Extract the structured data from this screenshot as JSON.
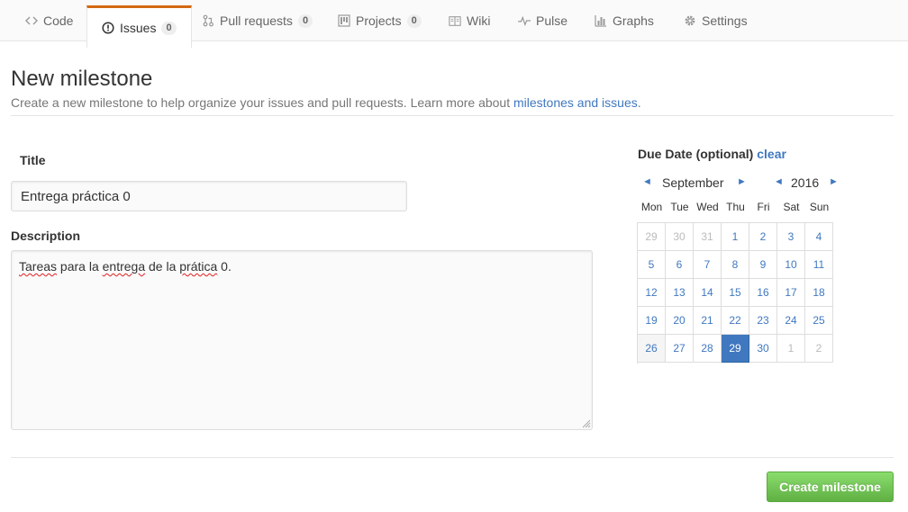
{
  "nav": {
    "tabs": [
      {
        "label": "Code",
        "icon": "code-icon"
      },
      {
        "label": "Issues",
        "icon": "issue-opened-icon",
        "count": "0",
        "selected": true
      },
      {
        "label": "Pull requests",
        "icon": "git-pull-request-icon",
        "count": "0"
      },
      {
        "label": "Projects",
        "icon": "project-icon",
        "count": "0"
      },
      {
        "label": "Wiki",
        "icon": "book-icon"
      },
      {
        "label": "Pulse",
        "icon": "pulse-icon"
      },
      {
        "label": "Graphs",
        "icon": "graph-icon"
      },
      {
        "label": "Settings",
        "icon": "gear-icon"
      }
    ],
    "accent_color": "#d26911"
  },
  "header": {
    "title": "New milestone",
    "subtitle": "Create a new milestone to help organize your issues and pull requests. Learn more about ",
    "link_text": "milestones and issues",
    "subtitle_end": "."
  },
  "form": {
    "title_label": "Title",
    "title_value": "Entrega práctica 0",
    "description_label": "Description",
    "description_words": [
      "Tareas",
      " para la ",
      "entrega",
      " de la ",
      "prática",
      " 0."
    ]
  },
  "due_date": {
    "label": "Due Date (optional)",
    "clear_label": "clear",
    "prev_arrow": "◄",
    "next_arrow": "►",
    "month": "September",
    "year": "2016",
    "weekdays": [
      "Mon",
      "Tue",
      "Wed",
      "Thu",
      "Fri",
      "Sat",
      "Sun"
    ],
    "weeks": [
      [
        "29",
        "30",
        "31",
        "1",
        "2",
        "3",
        "4"
      ],
      [
        "5",
        "6",
        "7",
        "8",
        "9",
        "10",
        "11"
      ],
      [
        "12",
        "13",
        "14",
        "15",
        "16",
        "17",
        "18"
      ],
      [
        "19",
        "20",
        "21",
        "22",
        "23",
        "24",
        "25"
      ],
      [
        "26",
        "27",
        "28",
        "29",
        "30",
        "1",
        "2"
      ]
    ],
    "other_month_cells": [
      "0-0",
      "0-1",
      "0-2",
      "4-5",
      "4-6"
    ],
    "today_cell": "4-0",
    "selected_cell": "4-3",
    "selected_color": "#4078c0"
  },
  "footer": {
    "create_label": "Create milestone",
    "create_color": "#60b044"
  }
}
